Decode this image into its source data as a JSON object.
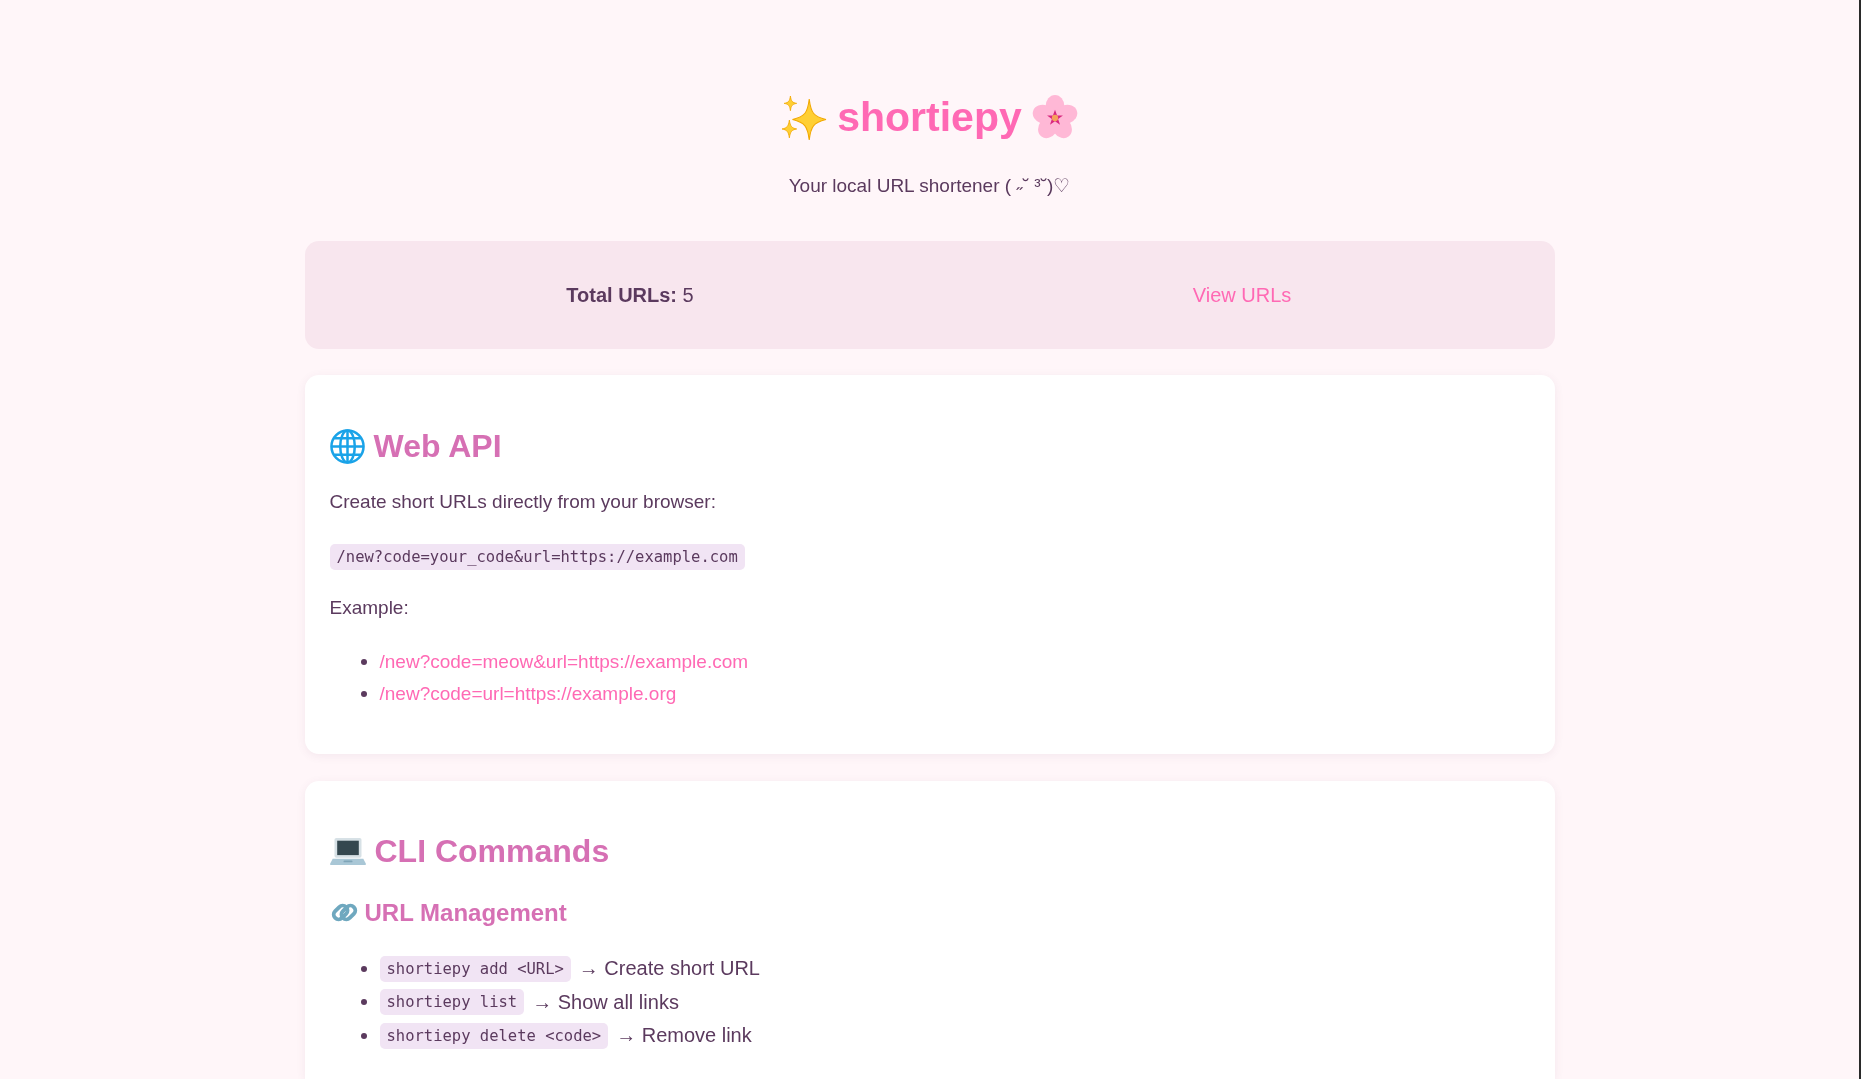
{
  "header": {
    "title": "shortiepy",
    "subtitle": "Your local URL shortener ( ˶˘ ³˘)♡"
  },
  "stats_bar": {
    "total": "**Total URLs:** 5",
    "view_link": "View URLs"
  },
  "web_api_card": {
    "heading": "Web API",
    "intro": "Create short URLs directly from your browser:",
    "code": "/new?code=your_code&url=https://example.com",
    "example_label": "Example:",
    "examples": [
      "/new?code=meow&url=https://example.com",
      "/new?code=url=https://example.org"
    ]
  },
  "cli_card": {
    "heading": "CLI Commands",
    "subsections": [
      {
        "heading": "URL Management",
        "commands": [
          {
            "command": "shortiepy add <URL>",
            "description": "→ Create short URL"
          },
          {
            "command": "shortiepy list",
            "description": "→ Show all links"
          },
          {
            "command": "shortiepy delete <code>",
            "description": "→ Remove link"
          }
        ]
      }
    ]
  }
}
